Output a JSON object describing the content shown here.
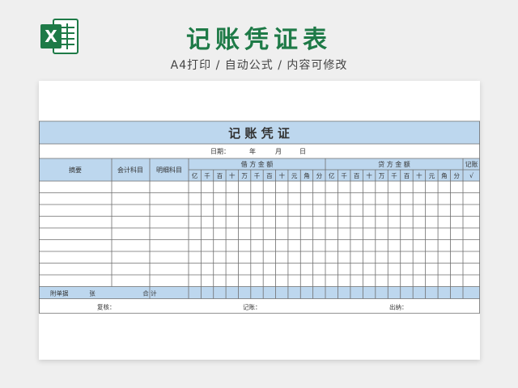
{
  "header": {
    "title": "记账凭证表",
    "subtitle": "A4打印 / 自动公式 / 内容可修改",
    "logo_letter": "X"
  },
  "voucher": {
    "title": "记 账 凭 证",
    "date_label": "日期：",
    "year_label": "年",
    "month_label": "月",
    "day_label": "日",
    "col_summary": "摘要",
    "col_account": "会计科目",
    "col_detail": "明细科目",
    "col_debit": "借 方 金 额",
    "col_credit": "贷 方 金 额",
    "col_posted": "记账",
    "posted_mark": "√",
    "digit_units": [
      "亿",
      "千",
      "百",
      "十",
      "万",
      "千",
      "百",
      "十",
      "元",
      "角",
      "分"
    ],
    "attach_label": "附单据",
    "attach_unit": "张",
    "total_label": "合 计",
    "reviewer_label": "复核：",
    "bookkeeper_label": "记账：",
    "cashier_label": "出纳：",
    "body_rows": 9
  },
  "colors": {
    "brand_green": "#1e7a47",
    "header_blue": "#bdd7ee",
    "grid_line": "#6e6e6e"
  }
}
